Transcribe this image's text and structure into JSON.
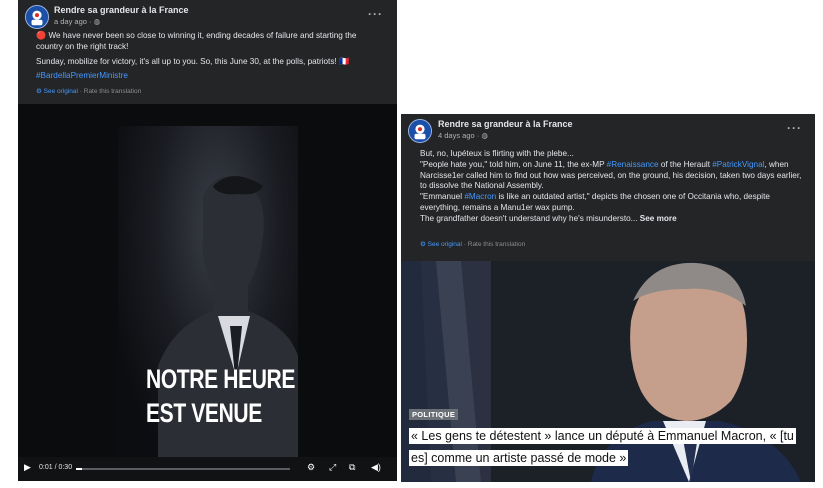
{
  "post1": {
    "page_name": "Rendre sa grandeur à la France",
    "time": "a day ago · ",
    "paragraphs": [
      "🔴 We have never been so close to winning it, ending decades of failure and starting the country on the right track!",
      "Sunday, mobilize for victory, it's all up to you. So, this June 30, at the polls, patriots! 🇫🇷"
    ],
    "hashtag": "#BardellaPremierMinistre",
    "see_original": "See original",
    "rate_translation": " · Rate this translation",
    "video_overlay_line1": "NOTRE HEURE",
    "video_overlay_line2": "EST VENUE",
    "video_time": "0:01 / 0:30",
    "progress": 0.03
  },
  "post2": {
    "page_name": "Rendre sa grandeur à la France",
    "time": "4 days ago · ",
    "line1": "But, no, Iupéteux is flirting with the plebe...",
    "p2_a": "\"People hate you,\" told him, on June 11, the ex-MP ",
    "p2_tag1": "#Renaissance",
    "p2_b": " of the Herault ",
    "p2_tag2": "#PatrickVignal",
    "p2_c": ", when Narcisse1er called him to find out how was perceived, on the ground, his decision, taken two days earlier, to dissolve the National Assembly.",
    "p3_a": "\"Emmanuel ",
    "p3_tag": "#Macron",
    "p3_b": " is like an outdated artist,\" depicts the chosen one of Occitania who, despite everything, remains a Manu1er wax pump.",
    "p4": "The grandfather doesn't understand why he's misundersto...",
    "see_more": " See more",
    "see_original": "See original",
    "rate_translation": " · Rate this translation",
    "article_tag": "POLITIQUE",
    "article_title": "« Les gens te détestent » lance un député à Emmanuel Macron, « [tu es] comme un artiste passé de mode »"
  },
  "colors": {
    "card_bg": "#242526",
    "text": "#e4e6eb",
    "muted": "#b0b3b8",
    "link": "#4599ff"
  }
}
